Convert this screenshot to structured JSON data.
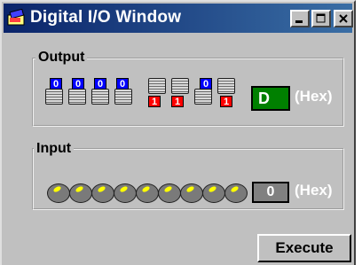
{
  "window": {
    "title": "Digital I/O Window"
  },
  "titlebar_buttons": {
    "minimize": "minimize-icon",
    "maximize": "maximize-icon",
    "close": "close-icon"
  },
  "output": {
    "label": "Output",
    "bits": [
      "0",
      "0",
      "0",
      "0",
      "1",
      "1",
      "0",
      "1"
    ],
    "hex_value": "D",
    "hex_label": "(Hex)"
  },
  "input": {
    "label": "Input",
    "led_count": 9,
    "hex_value": "0",
    "hex_label": "(Hex)"
  },
  "execute_label": "Execute",
  "colors": {
    "titlebar": "#0a246a",
    "bit_zero": "#0000ff",
    "bit_one": "#ff0000",
    "hex_box": "#008000"
  }
}
